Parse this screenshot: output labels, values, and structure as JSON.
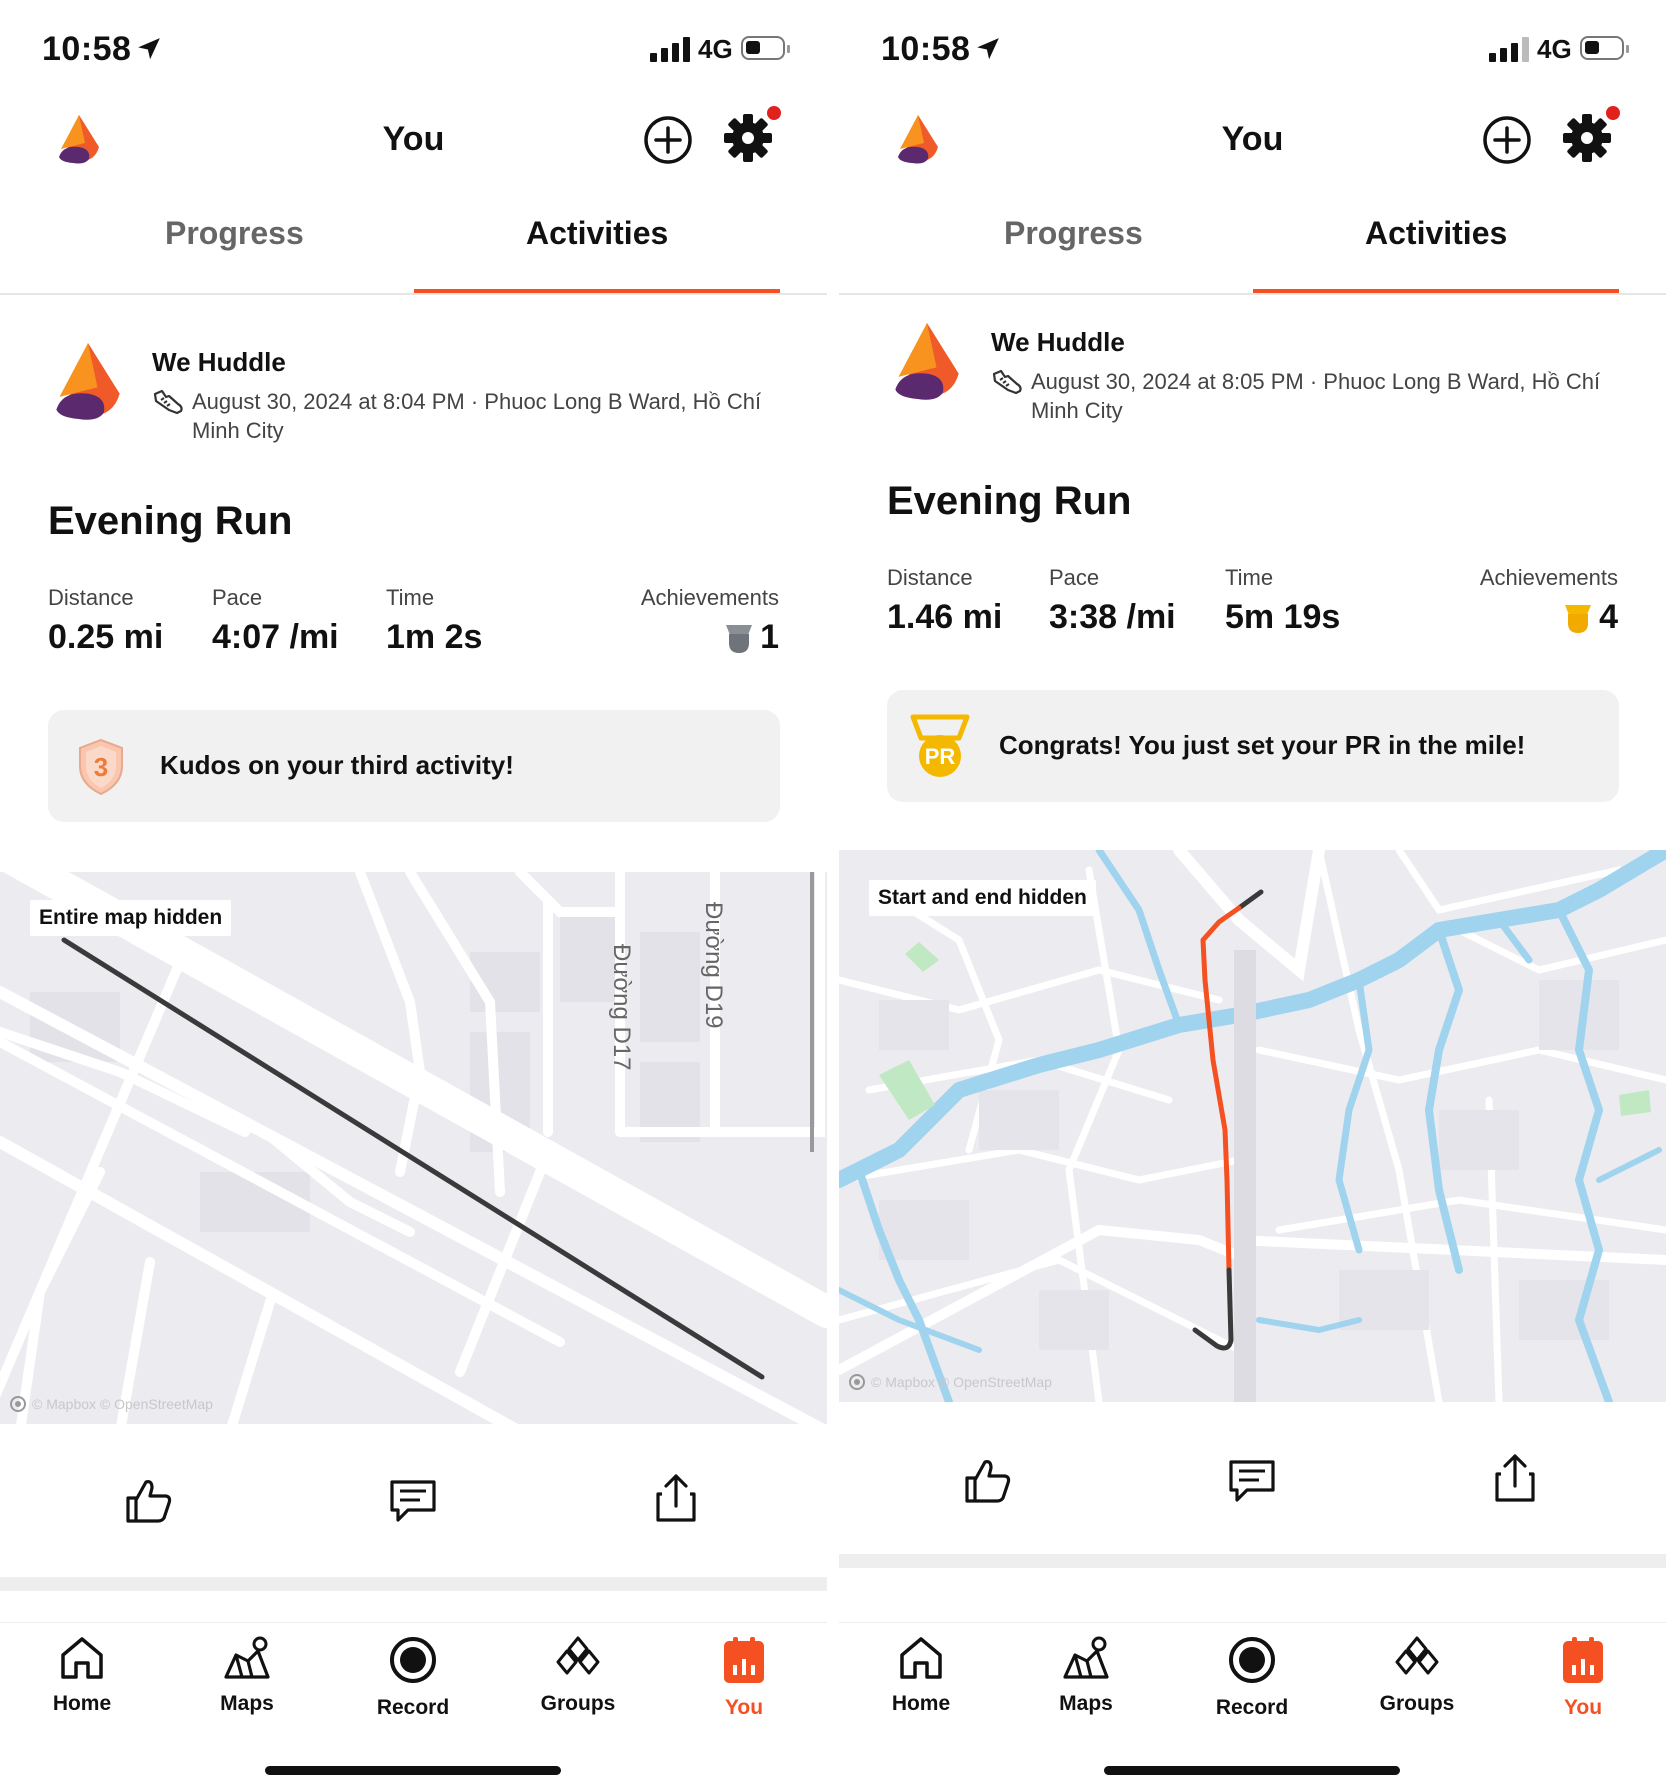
{
  "screens": [
    {
      "status": {
        "time": "10:58",
        "network": "4G"
      },
      "header": {
        "title": "You"
      },
      "tabs": {
        "progress": "Progress",
        "activities": "Activities"
      },
      "activity": {
        "athlete": "We Huddle",
        "meta": "August 30, 2024 at 8:04 PM · Phuoc Long B Ward, Hồ Chí Minh City",
        "title": "Evening Run",
        "stats": {
          "distance_label": "Distance",
          "distance": "0.25 mi",
          "pace_label": "Pace",
          "pace": "4:07 /mi",
          "time_label": "Time",
          "time": "1m 2s",
          "achievements_label": "Achievements",
          "achievements": "1"
        },
        "callout": "Kudos on your third activity!",
        "badge_number": "3",
        "map": {
          "badge": "Entire map hidden",
          "credit": "© Mapbox © OpenStreetMap",
          "street_labels": [
            "Đường D17",
            "Đường D19"
          ]
        }
      },
      "tabbar": [
        "Home",
        "Maps",
        "Record",
        "Groups",
        "You"
      ]
    },
    {
      "status": {
        "time": "10:58",
        "network": "4G"
      },
      "header": {
        "title": "You"
      },
      "tabs": {
        "progress": "Progress",
        "activities": "Activities"
      },
      "activity": {
        "athlete": "We Huddle",
        "meta": "August 30, 2024 at 8:05 PM · Phuoc Long B Ward, Hồ Chí Minh City",
        "title": "Evening Run",
        "stats": {
          "distance_label": "Distance",
          "distance": "1.46 mi",
          "pace_label": "Pace",
          "pace": "3:38 /mi",
          "time_label": "Time",
          "time": "5m 19s",
          "achievements_label": "Achievements",
          "achievements": "4"
        },
        "callout": "Congrats! You just set your PR in the mile!",
        "badge_text": "PR",
        "map": {
          "badge": "Start and end hidden",
          "credit": "© Mapbox © OpenStreetMap"
        }
      },
      "tabbar": [
        "Home",
        "Maps",
        "Record",
        "Groups",
        "You"
      ]
    }
  ],
  "colors": {
    "accent": "#f45022",
    "notification": "#e0211c",
    "map_bg": "#ececf0",
    "water": "#9fd3ee",
    "park": "#bfe8c3",
    "route": "#3a3a3a",
    "achievement_gold": "#f5b800",
    "achievement_gray": "#8a8f96"
  },
  "icons": {
    "header": [
      "location-arrow-icon",
      "add-circle-icon",
      "gear-icon"
    ],
    "actions": [
      "kudos-thumb-icon",
      "comment-icon",
      "share-icon"
    ],
    "tabbar": [
      "home-icon",
      "maps-icon",
      "record-icon",
      "groups-icon",
      "you-icon"
    ]
  }
}
